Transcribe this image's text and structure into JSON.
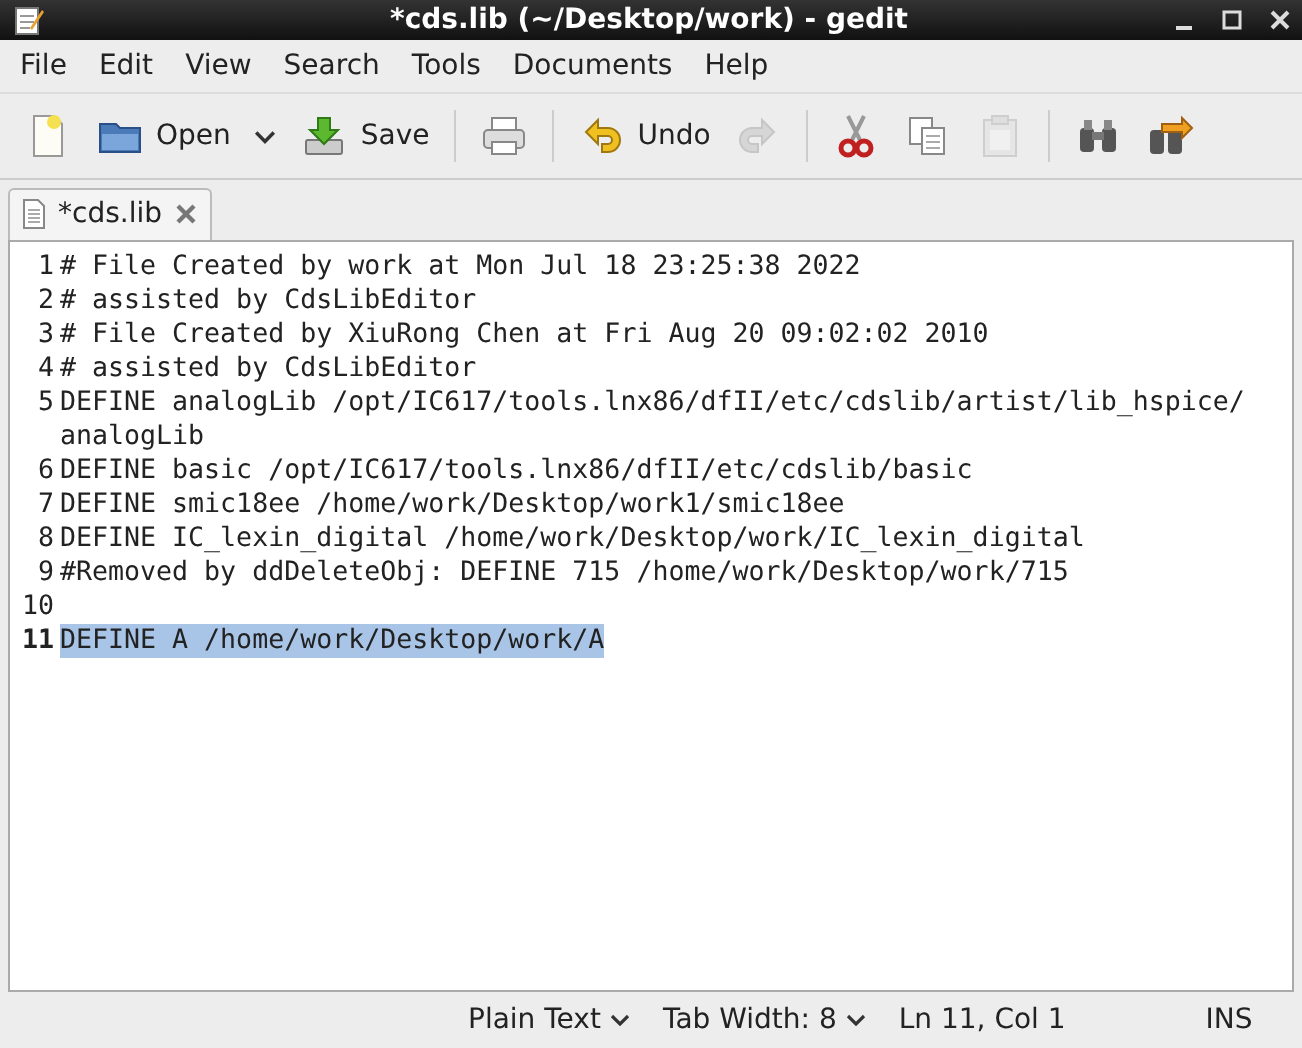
{
  "window": {
    "title": "*cds.lib (~/Desktop/work) - gedit"
  },
  "menu": [
    "File",
    "Edit",
    "View",
    "Search",
    "Tools",
    "Documents",
    "Help"
  ],
  "toolbar": [
    {
      "kind": "icon",
      "disabled": false
    },
    {
      "kind": "labeled",
      "label": "Open",
      "disabled": false
    },
    {
      "kind": "dropdown"
    },
    {
      "kind": "labeled",
      "label": "Save",
      "disabled": false
    },
    {
      "kind": "separator"
    },
    {
      "kind": "icon",
      "disabled": false
    },
    {
      "kind": "separator"
    },
    {
      "kind": "labeled",
      "label": "Undo",
      "disabled": false
    },
    {
      "kind": "icon",
      "disabled": true
    },
    {
      "kind": "separator"
    },
    {
      "kind": "icon",
      "disabled": false
    },
    {
      "kind": "icon",
      "disabled": false
    },
    {
      "kind": "icon",
      "disabled": true
    },
    {
      "kind": "separator"
    },
    {
      "kind": "icon",
      "disabled": false
    },
    {
      "kind": "icon",
      "disabled": false
    }
  ],
  "tabs": [
    {
      "label": "*cds.lib",
      "selected": true
    }
  ],
  "lines": [
    {
      "number": "1",
      "text": "# File Created by work at Mon Jul 18 23:25:38 2022",
      "current": false,
      "selected": false
    },
    {
      "number": "2",
      "text": "# assisted by CdsLibEditor",
      "current": false,
      "selected": false
    },
    {
      "number": "3",
      "text": "# File Created by XiuRong Chen at Fri Aug 20 09:02:02 2010",
      "current": false,
      "selected": false
    },
    {
      "number": "4",
      "text": "# assisted by CdsLibEditor",
      "current": false,
      "selected": false
    },
    {
      "number": "5",
      "text": "DEFINE analogLib /opt/IC617/tools.lnx86/dfII/etc/cdslib/artist/lib_hspice/analogLib",
      "current": false,
      "selected": false
    },
    {
      "number": "6",
      "text": "DEFINE basic /opt/IC617/tools.lnx86/dfII/etc/cdslib/basic",
      "current": false,
      "selected": false
    },
    {
      "number": "7",
      "text": "DEFINE smic18ee /home/work/Desktop/work1/smic18ee",
      "current": false,
      "selected": false
    },
    {
      "number": "8",
      "text": "DEFINE IC_lexin_digital /home/work/Desktop/work/IC_lexin_digital",
      "current": false,
      "selected": false
    },
    {
      "number": "9",
      "text": "#Removed by ddDeleteObj: DEFINE 715 /home/work/Desktop/work/715",
      "current": false,
      "selected": false
    },
    {
      "number": "10",
      "current": false,
      "selected": false
    },
    {
      "number": "11",
      "text": "DEFINE A /home/work/Desktop/work/A",
      "current": true,
      "selected": true
    }
  ],
  "status_bar": {
    "language": "Plain Text",
    "tab_width": "Tab Width: 8",
    "position": "Ln 11, Col 1",
    "mode": "INS"
  }
}
